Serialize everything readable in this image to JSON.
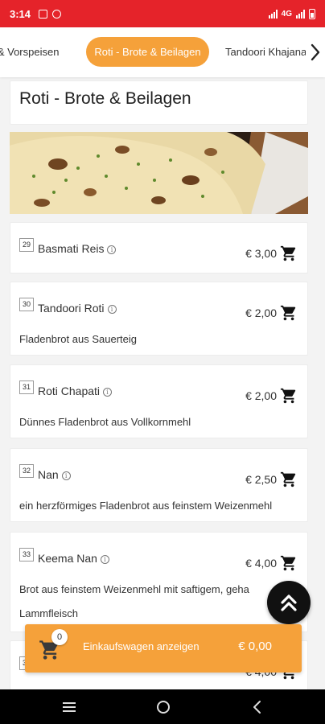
{
  "status_bar": {
    "time": "3:14",
    "network": "4G"
  },
  "tabs": [
    {
      "label": "n & Vorspeisen",
      "active": false
    },
    {
      "label": "Roti - Brote & Beilagen",
      "active": true
    },
    {
      "label": "Tandoori Khajana",
      "active": false
    }
  ],
  "category": {
    "title": "Roti - Brote & Beilagen"
  },
  "items": [
    {
      "number": "29",
      "name": "Basmati Reis",
      "price": "€ 3,00",
      "description": ""
    },
    {
      "number": "30",
      "name": "Tandoori Roti",
      "price": "€ 2,00",
      "description": "Fladenbrot aus Sauerteig"
    },
    {
      "number": "31",
      "name": "Roti Chapati",
      "price": "€ 2,00",
      "description": "Dünnes Fladenbrot aus Vollkornmehl"
    },
    {
      "number": "32",
      "name": "Nan",
      "price": "€ 2,50",
      "description": "ein herzförmiges Fladenbrot aus feinstem Weizenmehl"
    },
    {
      "number": "33",
      "name": "Keema Nan",
      "price": "€ 4,00",
      "description_line1": "Brot aus feinstem Weizenmehl mit saftigem, geha",
      "description_line2": "Lammfleisch"
    },
    {
      "number": "34",
      "name": "",
      "price": "€ 4,00",
      "description": ""
    }
  ],
  "cart": {
    "count": "0",
    "label": "Einkaufswagen anzeigen",
    "total": "€ 0,00"
  },
  "colors": {
    "status_bar": "#e5232a",
    "accent": "#f5a13a"
  },
  "icons": {
    "tab_next": "chevron-right-icon",
    "add_to_cart": "shopping-cart-icon",
    "scroll_top": "double-chevron-up-icon",
    "info": "info-icon"
  }
}
